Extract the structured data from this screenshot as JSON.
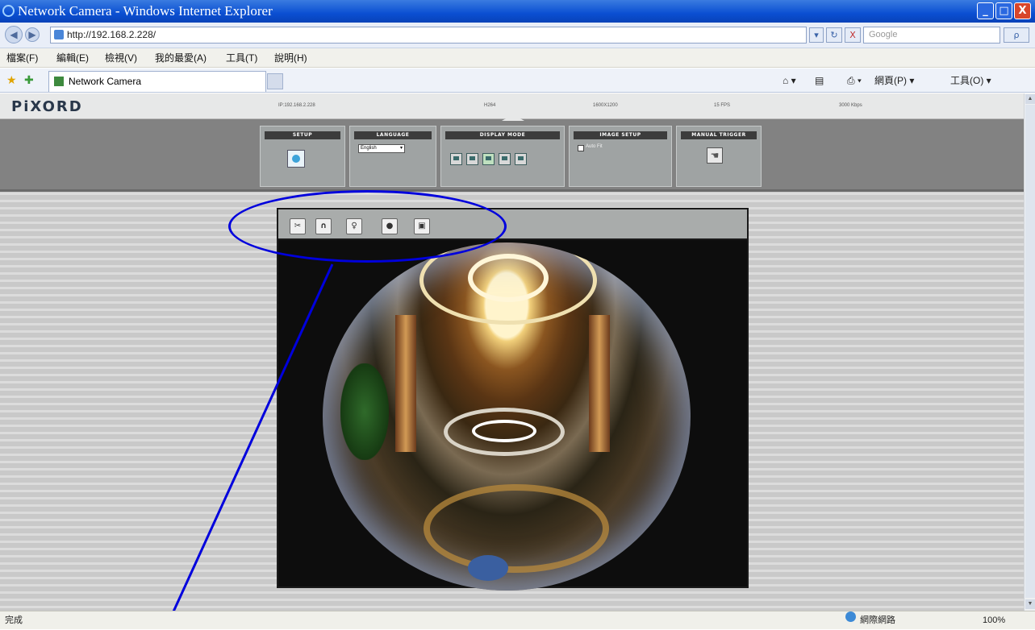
{
  "window": {
    "title": "Network Camera - Windows Internet Explorer",
    "controls": {
      "minimize": "_",
      "maximize": "□",
      "close": "X"
    }
  },
  "address": {
    "url": "http://192.168.2.228/",
    "search_placeholder": "Google",
    "go_label": "▾",
    "refresh_label": "↻",
    "stop_label": "X",
    "search_go": "ρ"
  },
  "menu": [
    "檔案(F)",
    "編輯(E)",
    "檢視(V)",
    "我的最愛(A)",
    "工具(T)",
    "說明(H)"
  ],
  "favorites": {
    "tab_title": "Network Camera",
    "commands": [
      "網頁(P) ▾",
      "工具(O) ▾"
    ]
  },
  "camera_page": {
    "brand": "PiXORD",
    "status": [
      "IP:192.168.2.228",
      "H264",
      "1600X1200",
      "15 FPS",
      "3000 Kbps"
    ],
    "panels": {
      "setup": "SETUP",
      "language": "LANGUAGE",
      "language_value": "English",
      "display_mode": "DISPLAY MODE",
      "image_setup": "IMAGE SETUP",
      "image_setup_option": "Auto Fit",
      "manual_trigger": "MANUAL TRIGGER"
    },
    "viewer_tools": [
      "✂",
      "∩",
      "♀",
      "●",
      "▣"
    ]
  },
  "statusbar": {
    "left": "完成",
    "zone": "網際網路",
    "zoom": "100%"
  },
  "colors": {
    "annotation": "#0000dd",
    "titlebar": "#0a4fd2"
  }
}
